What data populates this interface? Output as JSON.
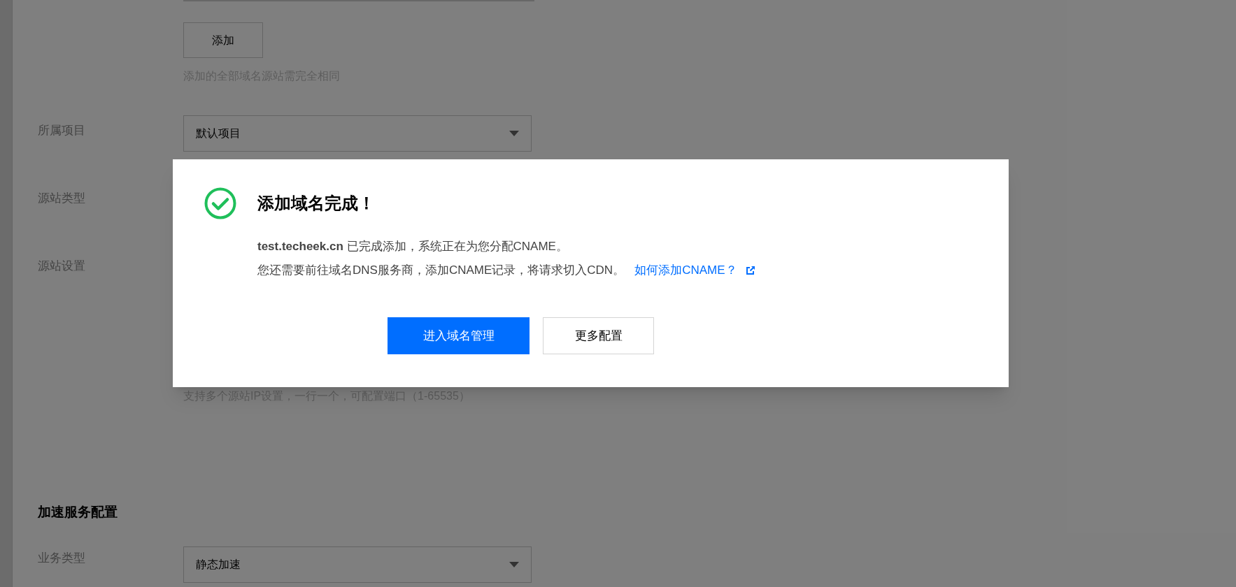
{
  "form": {
    "add_button": "添加",
    "add_hint": "添加的全部域名源站需完全相同",
    "fields": [
      {
        "label": "所属项目",
        "kind": "select",
        "value": "默认项目"
      },
      {
        "label": "源站类型",
        "kind": "label"
      },
      {
        "label": "源站设置",
        "kind": "label"
      }
    ],
    "origin_hint": "支持多个源站IP设置，一行一个，可配置端口（1-65535）"
  },
  "section": {
    "title": "加速服务配置",
    "fields": [
      {
        "label": "业务类型",
        "kind": "select",
        "value": "静态加速"
      }
    ]
  },
  "dialog": {
    "title": "添加域名完成！",
    "message": "**test.techeek.cn** 已完成添加，系统正在为您分配CNAME。",
    "instruction": "您还需要前往域名DNS服务商，添加CNAME记录，将请求切入CDN。",
    "help_link": "如何添加CNAME？",
    "buttons": [
      {
        "label": "进入域名管理",
        "kind": "primary"
      },
      {
        "label": "更多配置",
        "kind": "secondary"
      }
    ]
  }
}
